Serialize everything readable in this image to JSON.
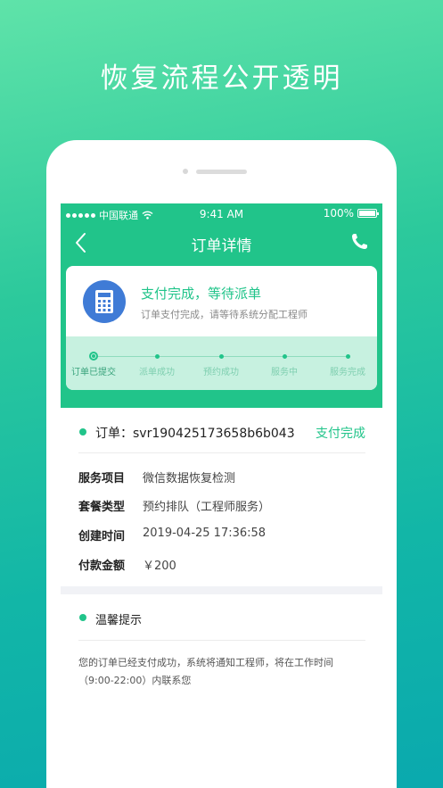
{
  "headline": "恢复流程公开透明",
  "status_bar": {
    "carrier": "中国联通",
    "time": "9:41 AM",
    "battery": "100%"
  },
  "nav": {
    "title": "订单详情",
    "back_icon": "chevron-left-icon",
    "phone_icon": "phone-icon"
  },
  "status_card": {
    "icon": "calculator-icon",
    "title": "支付完成，等待派单",
    "subtitle": "订单支付完成，请等待系统分配工程师",
    "steps": [
      "订单已提交",
      "派单成功",
      "预约成功",
      "服务中",
      "服务完成"
    ],
    "active_step": 0
  },
  "order": {
    "label": "订单：svr190425173658b6b043",
    "status": "支付完成",
    "details": [
      {
        "key": "服务项目",
        "value": "微信数据恢复检测"
      },
      {
        "key": "套餐类型",
        "value": "预约排队（工程师服务）"
      },
      {
        "key": "创建时间",
        "value": "2019-04-25 17:36:58"
      },
      {
        "key": "付款金额",
        "value": "￥200"
      }
    ]
  },
  "tips": {
    "title": "温馨提示",
    "text": "您的订单已经支付成功，系统将通知工程师，将在工作时间（9:00-22:00）内联系您"
  },
  "colors": {
    "primary": "#21c48a",
    "icon_blue": "#3f7bd6",
    "progress_bg": "#c7f1e0"
  }
}
